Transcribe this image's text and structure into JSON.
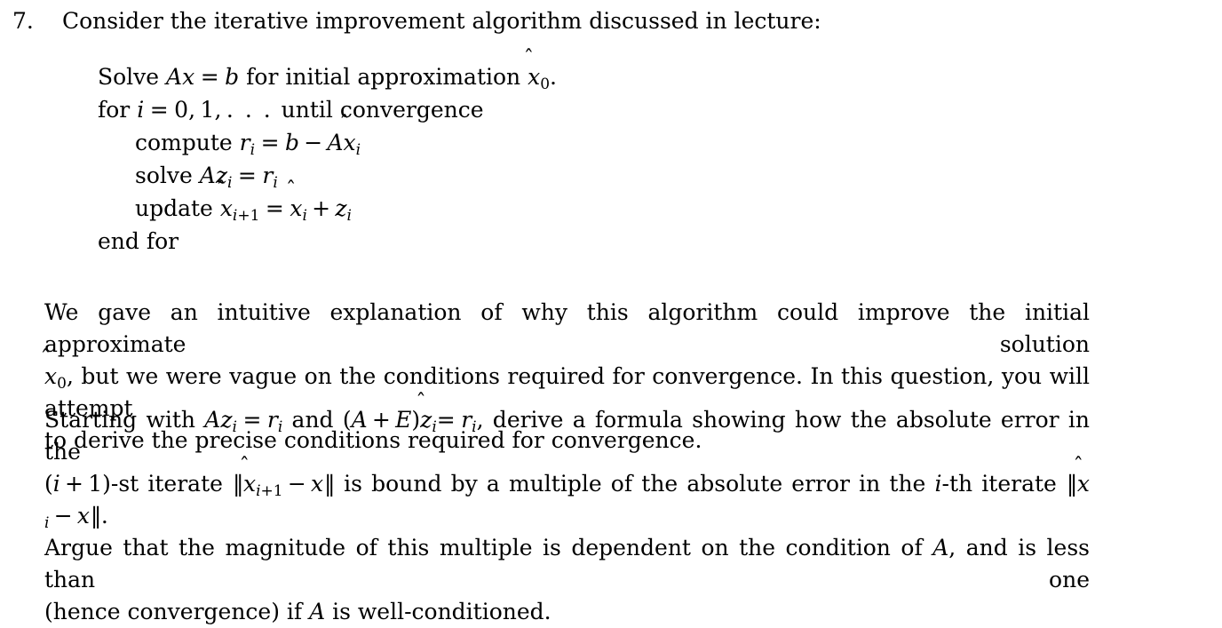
{
  "document": {
    "item_number": "7.",
    "heading": "Consider the iterative improvement algorithm discussed in lecture:",
    "algorithm": {
      "lines": [
        {
          "indent": 0,
          "text": "Solve Ax = b for initial approximation x̂0.",
          "keyword": "Solve"
        },
        {
          "indent": 0,
          "text": "for i = 0, 1, . . . until convergence",
          "keyword": "for"
        },
        {
          "indent": 1,
          "text": "compute ri = b − Ax̂i",
          "keyword": "compute"
        },
        {
          "indent": 1,
          "text": "solve Azi = ri",
          "keyword": "solve"
        },
        {
          "indent": 1,
          "text": "update x̂i+1 = x̂i + zi",
          "keyword": "update"
        },
        {
          "indent": 0,
          "text": "end for",
          "keyword": "end for"
        }
      ],
      "end_label": "end for"
    },
    "paragraph_1": {
      "line_1": "We gave an intuitive explanation of why this algorithm could improve the initial approximate solution",
      "line_2_prefix": ", but we were vague on the conditions required for convergence. In this question, you will attempt",
      "line_3": "to derive the precise conditions required for convergence.",
      "full_text": "We gave an intuitive explanation of why this algorithm could improve the initial approximate solution x̂0, but we were vague on the conditions required for convergence. In this question, you will attempt to derive the precise conditions required for convergence."
    },
    "paragraph_2": {
      "seg_start": "Starting with ",
      "seg_and": " and ",
      "seg_derive": ", derive a formula showing how the absolute error in the",
      "seg_st_iterate": "-st iterate ",
      "seg_bound": " is bound by a multiple of the absolute error in the ",
      "seg_ith": "-th iterate ",
      "line_3": "Argue that the magnitude of this multiple is dependent on the condition of A, and is less than one",
      "line_4": "(hence convergence) if A is well-conditioned.",
      "full_text": "Starting with Azi = ri and (A + E)ẑi = ri, derive a formula showing how the absolute error in the (i + 1)-st iterate ‖x̂i+1 − x‖ is bound by a multiple of the absolute error in the i-th iterate ‖x̂i − x‖. Argue that the magnitude of this multiple is dependent on the condition of A, and is less than one (hence convergence) if A is well-conditioned."
    },
    "symbols": {
      "hat_accent": "̂",
      "minus": "−",
      "plus": "+",
      "equals": "=",
      "ldots": ". . .",
      "norm_bar": "‖"
    }
  }
}
